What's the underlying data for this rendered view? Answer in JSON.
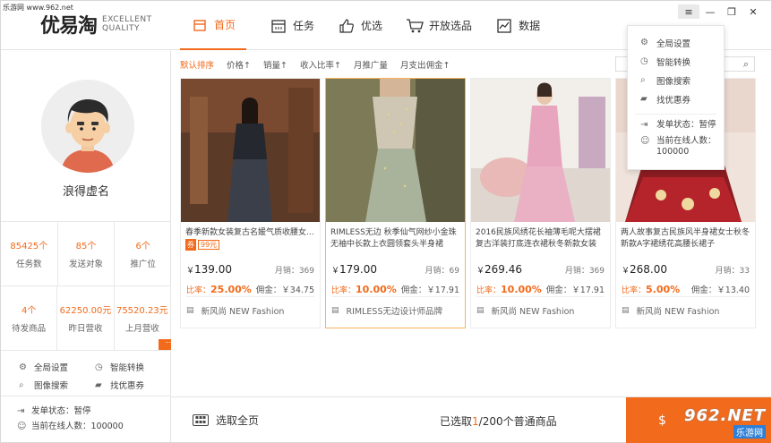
{
  "watermark_top": "乐游网 www.962.net",
  "logo": {
    "cn": "优易淘",
    "en_line1": "EXCELLENT",
    "en_line2": "QUALITY"
  },
  "nav": [
    {
      "label": "首页",
      "icon": "home-icon",
      "active": true
    },
    {
      "label": "任务",
      "icon": "calendar-icon"
    },
    {
      "label": "优选",
      "icon": "thumbs-up-icon"
    },
    {
      "label": "开放选品",
      "icon": "cart-icon"
    },
    {
      "label": "数据",
      "icon": "chart-icon"
    }
  ],
  "window_controls": {
    "menu": "≡",
    "minimize": "—",
    "restore": "❐",
    "close": "✕"
  },
  "user": {
    "name": "浪得虚名"
  },
  "stats": [
    [
      {
        "value": "85425个",
        "label": "任务数"
      },
      {
        "value": "85个",
        "label": "发送对象"
      },
      {
        "value": "6个",
        "label": "推广位"
      }
    ],
    [
      {
        "value": "4个",
        "label": "待发商品"
      },
      {
        "value": "62250.00元",
        "label": "昨日营收"
      },
      {
        "value": "75520.23元",
        "label": "上月营收"
      }
    ]
  ],
  "sidebar_links": [
    {
      "label": "全局设置",
      "icon": "gear-icon"
    },
    {
      "label": "智能转换",
      "icon": "clock-icon"
    },
    {
      "label": "图像搜索",
      "icon": "search-icon"
    },
    {
      "label": "找优惠券",
      "icon": "coupon-icon"
    }
  ],
  "sidebar_status": {
    "send_state": "发单状态：暂停",
    "online_users": "当前在线人数：100000"
  },
  "filters": [
    {
      "label": "默认排序",
      "active": true
    },
    {
      "label": "价格↑"
    },
    {
      "label": "销量↑"
    },
    {
      "label": "收入比率↑"
    },
    {
      "label": "月推广量"
    },
    {
      "label": "月支出佣金↑"
    }
  ],
  "products": [
    {
      "title": "春季新款女装复古名媛气质收腰女...",
      "tag": "券",
      "coupon": "99元",
      "price": "139.00",
      "monthly_sales": "月销：369",
      "rate": "25.00%",
      "commission": "佣金：￥34.75",
      "shop": "新风尚 NEW Fashion",
      "selected": false
    },
    {
      "title": "RIMLESS无边 秋季仙气网纱小金珠无袖中长款上衣圆领套头半身裙",
      "price": "179.00",
      "monthly_sales": "月销：69",
      "rate": "10.00%",
      "commission": "佣金：￥17.91",
      "shop": "RIMLESS无边设计师品牌",
      "selected": true
    },
    {
      "title": "2016民族风绣花长袖薄毛呢大摆裙复古洋装打底连衣裙秋冬新款女装",
      "price": "269.46",
      "monthly_sales": "月销：369",
      "rate": "10.00%",
      "commission": "佣金：￥17.91",
      "shop": "新风尚 NEW Fashion",
      "selected": false
    },
    {
      "title": "两人故事复古民族风半身裙女士秋冬新款A字裙绣花高腰长裙子",
      "price": "268.00",
      "monthly_sales": "月销：33",
      "rate": "5.00%",
      "commission": "佣金：￥13.40",
      "shop": "新风尚 NEW Fashion",
      "selected": false
    }
  ],
  "labels": {
    "currency": "￥",
    "rate_prefix": "比率："
  },
  "dropdown": {
    "items": [
      {
        "label": "全局设置",
        "icon": "gear-icon"
      },
      {
        "label": "智能转换",
        "icon": "clock-icon"
      },
      {
        "label": "图像搜索",
        "icon": "search-icon"
      },
      {
        "label": "找优惠券",
        "icon": "coupon-icon"
      }
    ],
    "send_state": "发单状态：暂停",
    "online_label": "当前在线人数：",
    "online_value": "100000"
  },
  "bottom": {
    "select_all": "选取全页",
    "selected_prefix": "已选取",
    "selected_num": "1",
    "selected_suffix": "/200个普通商品"
  },
  "watermark_bottom": {
    "big": "962.NET",
    "small": "乐游网"
  },
  "colors": {
    "accent": "#f26a1b"
  }
}
